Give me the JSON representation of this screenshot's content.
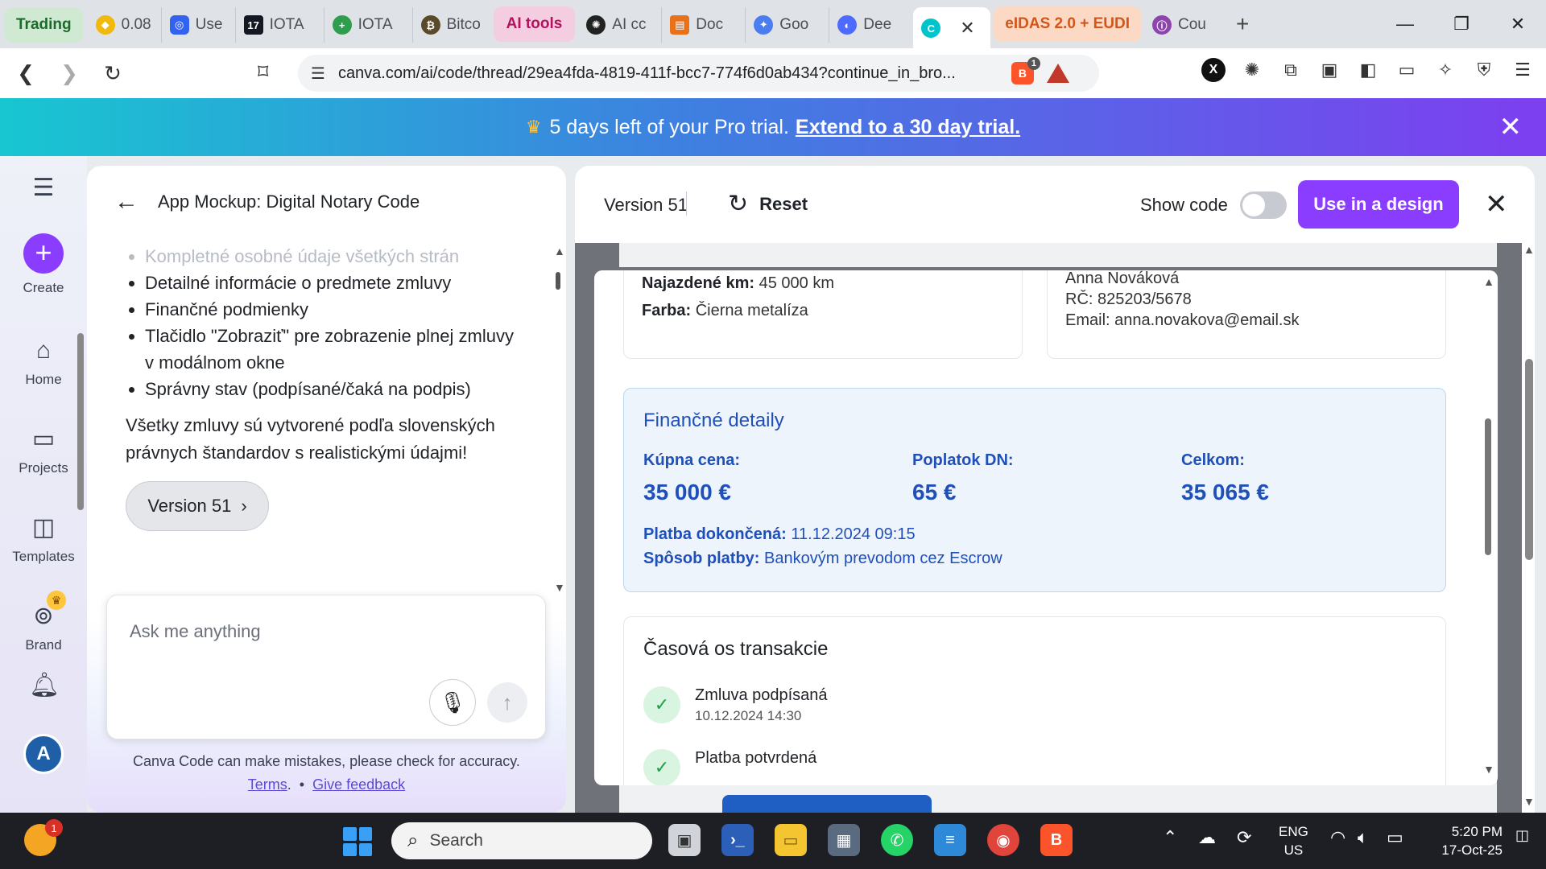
{
  "browser": {
    "tabs": [
      {
        "label": "Trading",
        "kind": "group-green"
      },
      {
        "label": "0.08",
        "icon": "binance-icon",
        "color": "#f0b90b"
      },
      {
        "label": "Use",
        "icon": "wallet-icon",
        "color": "#3462f0"
      },
      {
        "label": "IOTA",
        "icon": "tradingview-icon",
        "color": "#131722"
      },
      {
        "label": "IOTA",
        "icon": "plus-circle-icon",
        "color": "#2e9e4c"
      },
      {
        "label": "Bitco",
        "icon": "bitcoin-icon",
        "color": "#5a4a2a"
      },
      {
        "label": "AI tools",
        "kind": "group-pink"
      },
      {
        "label": "AI cc",
        "icon": "openai-icon",
        "color": "#222222"
      },
      {
        "label": "Doc",
        "icon": "docs-icon",
        "color": "#e8711a"
      },
      {
        "label": "Goo",
        "icon": "gemini-icon",
        "color": "#4a7df0"
      },
      {
        "label": "Dee",
        "icon": "deepseek-icon",
        "color": "#4d6bfe"
      },
      {
        "label": "",
        "icon": "canva-icon",
        "color": "#00c4cc",
        "active": true
      },
      {
        "label": "eIDAS 2.0 + EUDI",
        "kind": "group-orange"
      },
      {
        "label": "Cou",
        "icon": "course-icon",
        "color": "#8e44ad"
      }
    ],
    "url": "canva.com/ai/code/thread/29ea4fda-4819-411f-bcc7-774f6d0ab434?continue_in_bro...",
    "shield_count": "1"
  },
  "banner": {
    "text": "5 days left of your Pro trial.",
    "link": "Extend to a 30 day trial."
  },
  "rail": {
    "create": "Create",
    "home": "Home",
    "projects": "Projects",
    "templates": "Templates",
    "brand": "Brand",
    "avatar": "A"
  },
  "chat": {
    "title": "App Mockup: Digital Notary Code",
    "bullets": [
      "Kompletné osobné údaje všetkých strán",
      "Detailné informácie o predmete zmluvy",
      "Finančné podmienky",
      "Tlačidlo \"Zobraziť\" pre zobrazenie plnej zmluvy v modálnom okne",
      "Správny stav (podpísané/čaká na podpis)"
    ],
    "paragraph": "Všetky zmluvy sú vytvorené podľa slovenských právnych štandardov s realistickými údajmi!",
    "version_chip": "Version 51",
    "input_placeholder": "Ask me anything",
    "disclaimer": "Canva Code can make mistakes, please check for accuracy.",
    "terms": "Terms",
    "feedback": "Give feedback"
  },
  "preview": {
    "version": "Version 51",
    "reset": "Reset",
    "show_code": "Show code",
    "use_in_design": "Use in a design",
    "car": {
      "km_label": "Najazdené km:",
      "km_value": "45 000 km",
      "color_label": "Farba:",
      "color_value": "Čierna metalíza"
    },
    "buyer": {
      "name": "Anna Nováková",
      "rc": "RČ: 825203/5678",
      "email": "Email: anna.novakova@email.sk"
    },
    "finance": {
      "title": "Finančné detaily",
      "price_label": "Kúpna cena:",
      "price_value": "35 000 €",
      "fee_label": "Poplatok DN:",
      "fee_value": "65 €",
      "total_label": "Celkom:",
      "total_value": "35 065 €",
      "paid_label": "Platba dokončená:",
      "paid_value": "11.12.2024 09:15",
      "method_label": "Spôsob platby:",
      "method_value": "Bankovým prevodom cez Escrow"
    },
    "timeline": {
      "title": "Časová os transakcie",
      "items": [
        {
          "title": "Zmluva podpísaná",
          "time": "10.12.2024 14:30"
        },
        {
          "title": "Platba potvrdená",
          "time": ""
        }
      ]
    }
  },
  "taskbar": {
    "search": "Search",
    "notif_count": "1",
    "lang_1": "ENG",
    "lang_2": "US",
    "time": "5:20 PM",
    "date": "17-Oct-25"
  },
  "colors": {
    "canva_purple": "#8b3dff",
    "finance_blue": "#1f4fb8",
    "success_green": "#1e9e45"
  }
}
